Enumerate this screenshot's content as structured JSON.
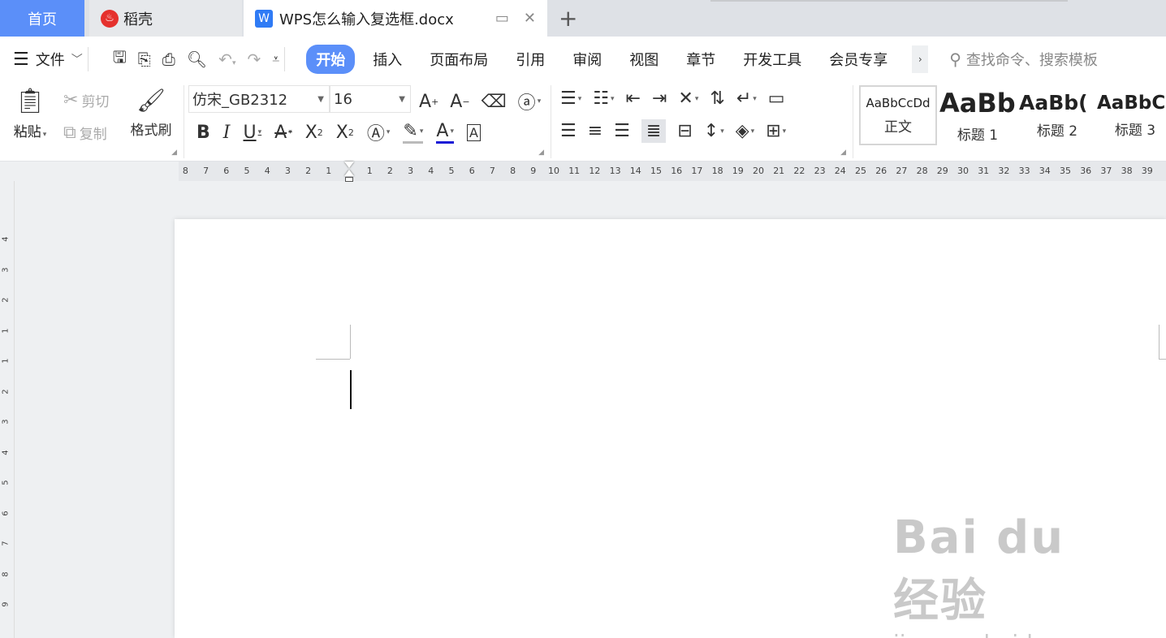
{
  "tabs": {
    "home": "首页",
    "daoke": "稻壳",
    "document": "WPS怎么输入复选框.docx",
    "add": "+"
  },
  "menu": {
    "file": "文件",
    "ribbon_tabs": [
      "开始",
      "插入",
      "页面布局",
      "引用",
      "审阅",
      "视图",
      "章节",
      "开发工具",
      "会员专享"
    ],
    "active_tab": "开始",
    "search_placeholder": "查找命令、搜索模板"
  },
  "ribbon": {
    "paste": "粘贴",
    "cut": "剪切",
    "copy": "复制",
    "format_painter": "格式刷",
    "font_name": "仿宋_GB2312",
    "font_size": "16",
    "styles": [
      {
        "preview": "AaBbCcDd",
        "name": "正文"
      },
      {
        "preview": "AaBb",
        "name": "标题 1"
      },
      {
        "preview": "AaBb(",
        "name": "标题 2"
      },
      {
        "preview": "AaBbC",
        "name": "标题 3"
      }
    ]
  },
  "ruler": {
    "left_numbers": [
      "8",
      "7",
      "6",
      "5",
      "4",
      "3",
      "2",
      "1"
    ],
    "right_numbers": [
      "1",
      "2",
      "3",
      "4",
      "5",
      "6",
      "7",
      "8",
      "9",
      "10",
      "11",
      "12",
      "13",
      "14",
      "15",
      "16",
      "17",
      "18",
      "19",
      "20",
      "21",
      "22",
      "23",
      "24",
      "25",
      "26",
      "27",
      "28",
      "29",
      "30",
      "31",
      "32",
      "33",
      "34",
      "35",
      "36",
      "37",
      "38",
      "39"
    ],
    "vertical_numbers": [
      "4",
      "3",
      "2",
      "1",
      "1",
      "2",
      "3",
      "4",
      "5",
      "6",
      "7",
      "8",
      "9"
    ]
  },
  "watermark": {
    "logo": "Bai du 经验",
    "url": "jingyan.baidu.com"
  }
}
